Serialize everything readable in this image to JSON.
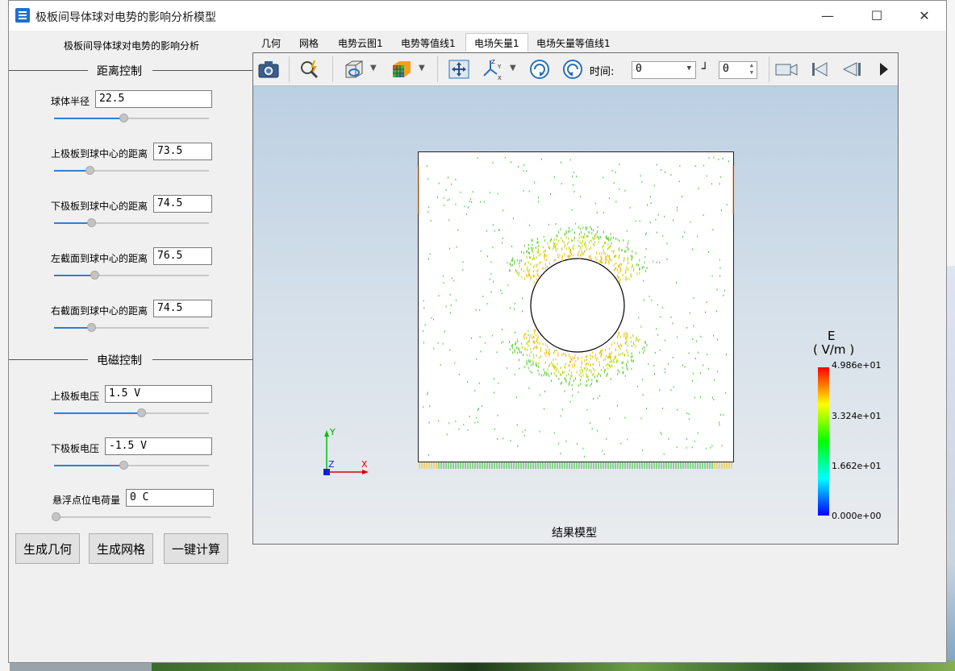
{
  "window": {
    "title": "极板间导体球对电势的影响分析模型",
    "controls": [
      "—",
      "☐",
      "✕"
    ]
  },
  "left_panel": {
    "title": "极板间导体球对电势的影响分析",
    "distance_section": "距离控制",
    "distance_fields": [
      {
        "label": "球体半径",
        "value": "22.5",
        "slider": 0.45
      },
      {
        "label": "上极板到球中心的距离",
        "value": "73.5",
        "slider": 0.23
      },
      {
        "label": "下极板到球中心的距离",
        "value": "74.5",
        "slider": 0.24
      },
      {
        "label": "左截面到球中心的距离",
        "value": "76.5",
        "slider": 0.26
      },
      {
        "label": "右截面到球中心的距离",
        "value": "74.5",
        "slider": 0.24
      }
    ],
    "em_section": "电磁控制",
    "em_fields": [
      {
        "label": "上极板电压",
        "value": "1.5 V",
        "slider": 0.56
      },
      {
        "label": "下极板电压",
        "value": "-1.5 V",
        "slider": 0.45
      },
      {
        "label": "悬浮点位电荷量",
        "value": "0 C",
        "slider": 0.0
      }
    ],
    "buttons": [
      "生成几何",
      "生成网格",
      "一键计算"
    ]
  },
  "tabs": [
    "几何",
    "网格",
    "电势云图1",
    "电势等值线1",
    "电场矢量1",
    "电场矢量等值线1"
  ],
  "active_tab": 4,
  "toolbar": {
    "time_label": "时间:",
    "time_value": "0",
    "step_value": "0"
  },
  "view": {
    "caption": "结果模型",
    "axis_labels": {
      "x": "X",
      "y": "Y",
      "z": "Z"
    }
  },
  "legend": {
    "title_line1": "E",
    "title_line2": "( V/m )",
    "ticks": [
      "4.986e+01",
      "3.324e+01",
      "1.662e+01",
      "0.000e+00"
    ]
  },
  "colors": {
    "accent": "#2f7fd8",
    "circle": "#000000",
    "arrow_hot": "#e8c800",
    "arrow_mid": "#22b020"
  }
}
